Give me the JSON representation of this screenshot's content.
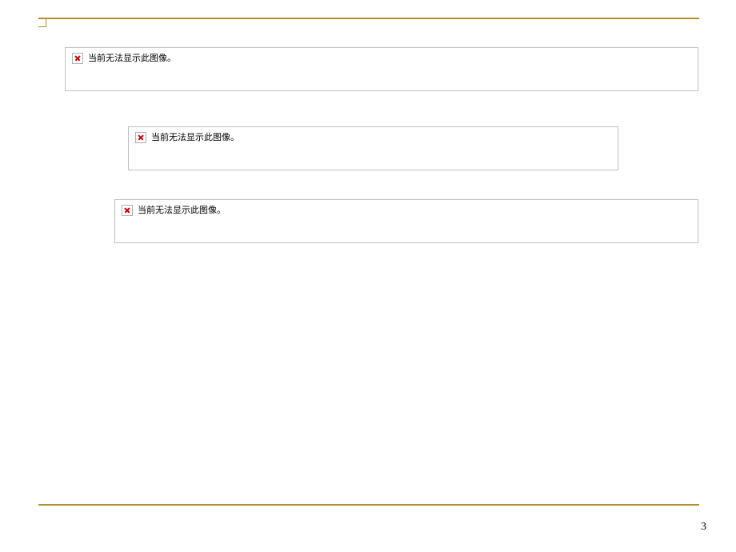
{
  "placeholders": {
    "text1": "当前无法显示此图像。",
    "text2": "当前无法显示此图像。",
    "text3": "当前无法显示此图像。"
  },
  "pageNumber": "3"
}
